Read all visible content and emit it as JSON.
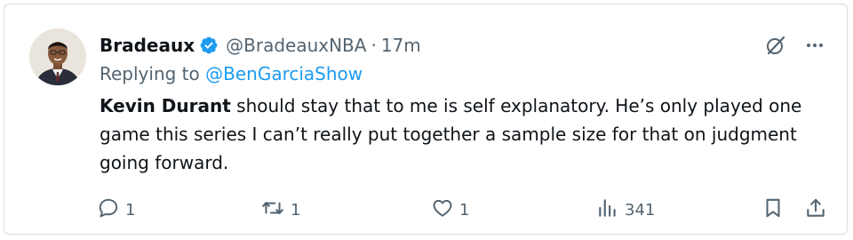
{
  "tweet": {
    "author": {
      "display_name": "Bradeaux",
      "handle": "@BradeauxNBA",
      "separator": "·",
      "time": "17m",
      "avatar": "avatar-photo",
      "verified_icon": "verified-badge-icon"
    },
    "reply": {
      "prefix": "Replying to",
      "target": "@BenGarciaShow"
    },
    "body": {
      "mention": "Kevin Durant",
      "text": " should stay that to me is self explanatory. He’s only played one game this series I can’t really put together a sample size for that on judgment going forward."
    },
    "top_icons": [
      "grok-icon",
      "more-icon"
    ],
    "actions": {
      "reply_count": "1",
      "retweet_count": "1",
      "like_count": "1",
      "views_count": "341"
    }
  },
  "colors": {
    "text": "#0f1419",
    "secondary": "#536471",
    "accent": "#1d9bf0",
    "border": "#d9dde1"
  }
}
